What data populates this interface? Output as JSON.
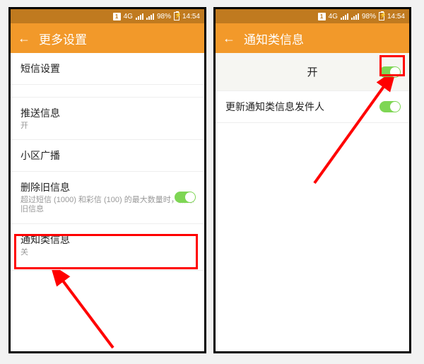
{
  "status": {
    "sim": "1",
    "net": "4G",
    "battery": "98%",
    "time": "14:54"
  },
  "left": {
    "title": "更多设置",
    "rows": {
      "sms": "短信设置",
      "push_t": "推送信息",
      "push_s": "开",
      "cell": "小区广播",
      "del_t": "删除旧信息",
      "del_s": "超过短信 (1000) 和彩信 (100) 的最大数量时，删除旧信息",
      "notif_t": "通知类信息",
      "notif_s": "关"
    }
  },
  "right": {
    "title": "通知类信息",
    "rows": {
      "on": "开",
      "update": "更新通知类信息发件人"
    }
  }
}
